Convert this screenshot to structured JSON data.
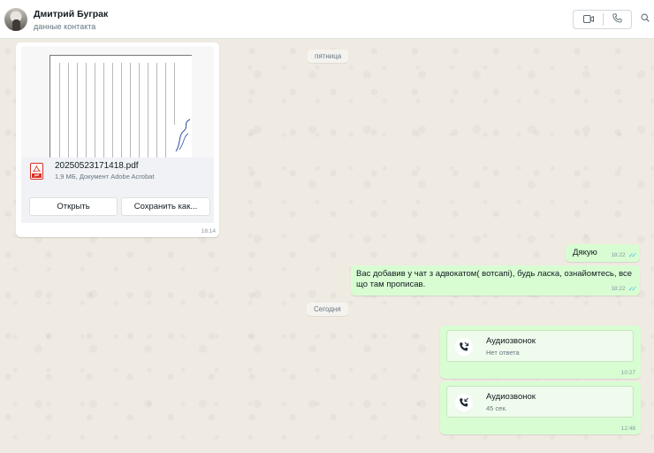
{
  "contact": {
    "name": "Дмитрий Буграк",
    "subtitle": "данные контакта"
  },
  "header_icons": [
    "video-call-icon",
    "voice-call-icon",
    "search-icon"
  ],
  "chips": {
    "friday": "пятница",
    "today": "Сегодня"
  },
  "document": {
    "file_name": "20250523171418.pdf",
    "meta": "1,9 МБ, Документ Adobe Acrobat",
    "icon_tag": "pdf",
    "open_label": "Открыть",
    "save_label": "Сохранить как...",
    "time": "18:14"
  },
  "messages": [
    {
      "text": "Дякую",
      "time": "18:22",
      "status": "read"
    },
    {
      "text_line1": "Вас добавив у чат з адвокатом( вотсапі), будь ласка, ознайомтесь, все",
      "text_line2": "що там прописав.",
      "time": "18:22",
      "status": "read"
    }
  ],
  "calls": [
    {
      "title": "Аудиозвонок",
      "subtitle": "Нет ответа",
      "time": "10:27",
      "icon": "missed-call-icon"
    },
    {
      "title": "Аудиозвонок",
      "subtitle": "45 сек.",
      "time": "12:48",
      "icon": "incoming-call-icon"
    }
  ],
  "colors": {
    "outgoing_bubble": "#d9fdd3",
    "chat_background": "#efeae2",
    "read_ticks": "#53bdeb",
    "pdf_red": "#d93025"
  }
}
